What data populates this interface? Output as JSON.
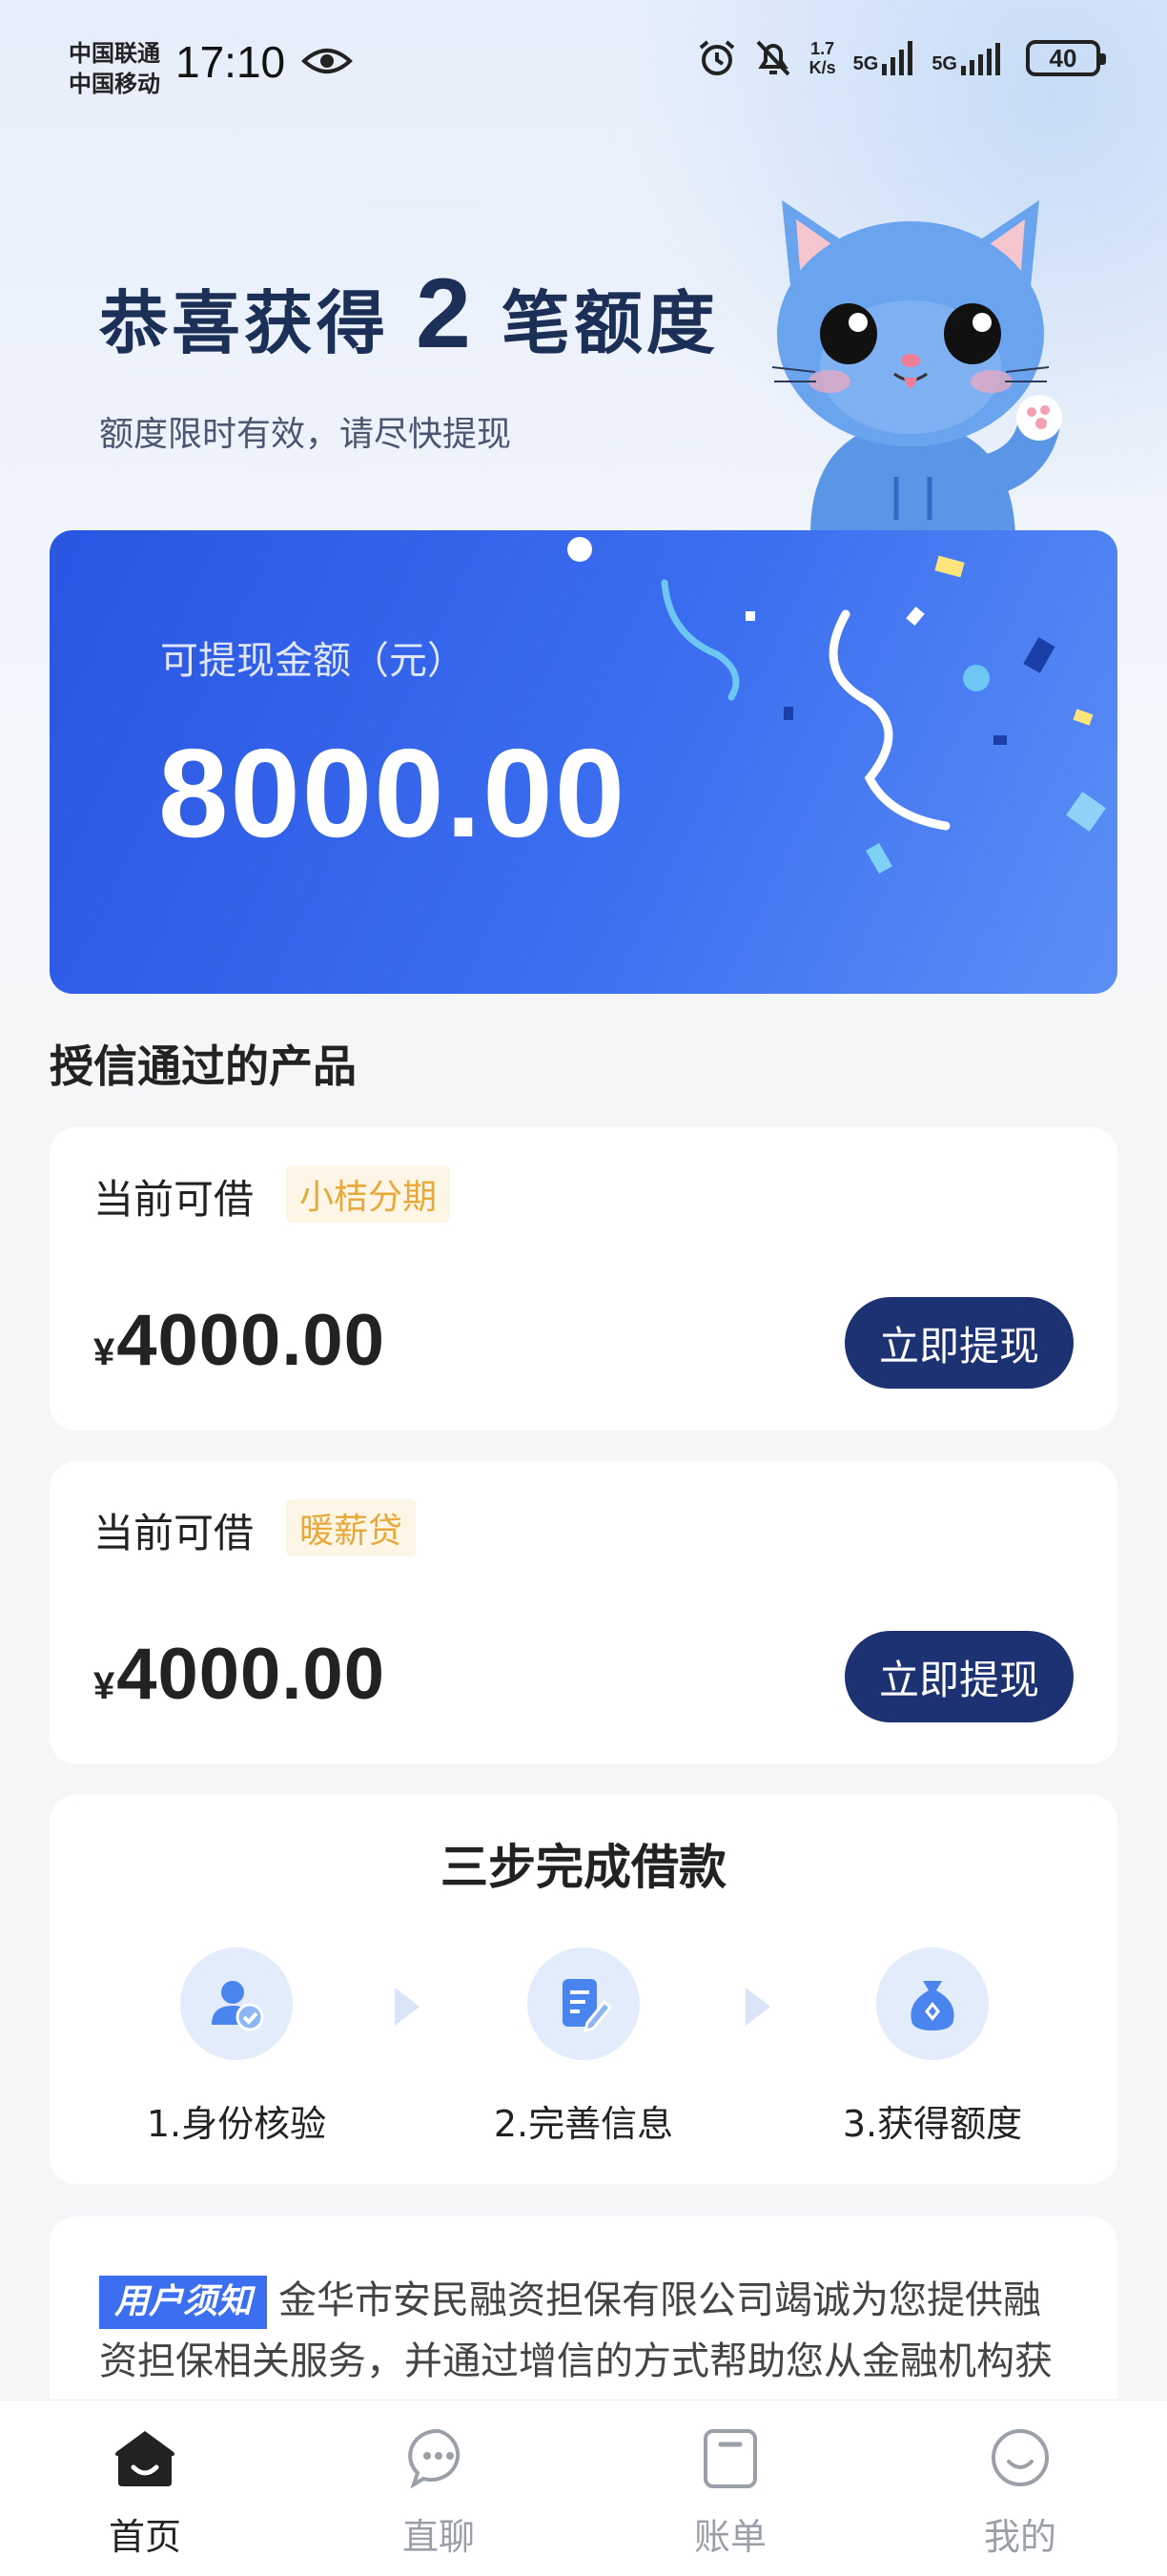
{
  "status_bar": {
    "carrier_1": "中国联通",
    "carrier_2": "中国移动",
    "time": "17:10",
    "net_speed_value": "1.7",
    "net_speed_unit": "K/s",
    "signal_1": "5G",
    "signal_2": "5G",
    "battery": "40"
  },
  "hero": {
    "title_prefix": "恭喜获得",
    "title_count": "2",
    "title_suffix": "笔额度",
    "subtitle": "额度限时有效，请尽快提现"
  },
  "amount_card": {
    "label": "可提现金额（元）",
    "value": "8000.00"
  },
  "products_title": "授信通过的产品",
  "products": [
    {
      "label": "当前可借",
      "tag": "小桔分期",
      "currency": "¥",
      "amount": "4000.00",
      "button": "立即提现"
    },
    {
      "label": "当前可借",
      "tag": "暖薪贷",
      "currency": "¥",
      "amount": "4000.00",
      "button": "立即提现"
    }
  ],
  "steps": {
    "title": "三步完成借款",
    "items": [
      {
        "label": "1.身份核验",
        "icon": "user-verify-icon"
      },
      {
        "label": "2.完善信息",
        "icon": "edit-document-icon"
      },
      {
        "label": "3.获得额度",
        "icon": "money-bag-icon"
      }
    ]
  },
  "notice": {
    "badge": "用户须知",
    "text": "金华市安民融资担保有限公司竭诚为您提供融资担保相关服务，并通过增信的方式帮助您从金融机构获"
  },
  "nav": {
    "items": [
      {
        "label": "首页",
        "icon": "home-icon",
        "active": true
      },
      {
        "label": "直聊",
        "icon": "chat-icon",
        "active": false
      },
      {
        "label": "账单",
        "icon": "bill-icon",
        "active": false
      },
      {
        "label": "我的",
        "icon": "profile-icon",
        "active": false
      }
    ]
  },
  "colors": {
    "card_blue": "#3b6ef0",
    "button_navy": "#1d3273",
    "tag_orange": "#e8a93a",
    "title_navy": "#1c2f57"
  }
}
